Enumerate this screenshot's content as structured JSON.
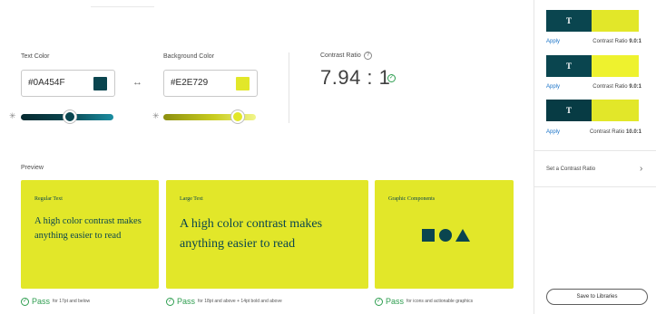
{
  "colors": {
    "text": "#0A454F",
    "background": "#E2E729",
    "pass_green": "#2D9D4F",
    "link_blue": "#1A73C8"
  },
  "text_color": {
    "label": "Text Color",
    "value": "#0A454F",
    "slider_level": 0.55
  },
  "background_color": {
    "label": "Background Color",
    "value": "#E2E729",
    "slider_level": 0.8
  },
  "contrast": {
    "label": "Contrast Ratio",
    "value": "7.94 : 1",
    "help_glyph": "?"
  },
  "preview": {
    "label": "Preview",
    "cards": [
      {
        "title": "Regular Text",
        "body": "A high color contrast makes anything easier to read"
      },
      {
        "title": "Large Text",
        "body": "A high color contrast makes anything easier to read"
      },
      {
        "title": "Graphic Components",
        "body": ""
      }
    ],
    "passes": [
      {
        "word": "Pass",
        "note": "for 17pt and below"
      },
      {
        "word": "Pass",
        "note": "for 18pt and above + 14pt bold and above"
      },
      {
        "word": "Pass",
        "note": "for icons and actionable graphics"
      }
    ]
  },
  "suggestions": [
    {
      "glyph": "T",
      "a": "#0A454F",
      "b": "#E2E729",
      "apply": "Apply",
      "ratio_label": "Contrast Ratio",
      "ratio": "9.0:1"
    },
    {
      "glyph": "T",
      "a": "#0A454F",
      "b": "#EEF22E",
      "apply": "Apply",
      "ratio_label": "Contrast Ratio",
      "ratio": "9.0:1"
    },
    {
      "glyph": "T",
      "a": "#073B44",
      "b": "#E2E729",
      "apply": "Apply",
      "ratio_label": "Contrast Ratio",
      "ratio": "10.0:1"
    }
  ],
  "set_ratio": {
    "label": "Set a Contrast Ratio",
    "chevron": "›"
  },
  "save_button": "Save to Libraries",
  "icons": {
    "swap": "↔",
    "check": "✓",
    "sun": "✳"
  }
}
